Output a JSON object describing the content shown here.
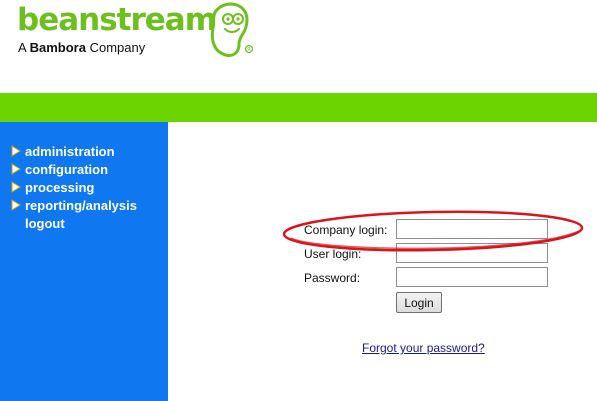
{
  "brand": {
    "name": "beanstream",
    "registered": "®",
    "tagline_prefix": "A",
    "tagline_bold": "Bambora",
    "tagline_suffix": "Company",
    "green": "#6cc01e",
    "bar_color": "#6cd400"
  },
  "sidebar": {
    "background": "#0f78f0",
    "items": [
      {
        "label": "administration",
        "icon": "triangle-right-icon"
      },
      {
        "label": "configuration",
        "icon": "triangle-right-icon"
      },
      {
        "label": "processing",
        "icon": "triangle-right-icon"
      },
      {
        "label": "reporting/analysis",
        "icon": "triangle-right-icon"
      },
      {
        "label": "logout",
        "icon": null
      }
    ]
  },
  "login_form": {
    "company_label": "Company login:",
    "company_value": "",
    "user_label": "User login:",
    "user_value": "",
    "password_label": "Password:",
    "password_value": "",
    "submit_label": "Login",
    "forgot_link": "Forgot your password?"
  },
  "annotation": {
    "highlight_color": "#d9151b",
    "target": "company-login-row"
  }
}
